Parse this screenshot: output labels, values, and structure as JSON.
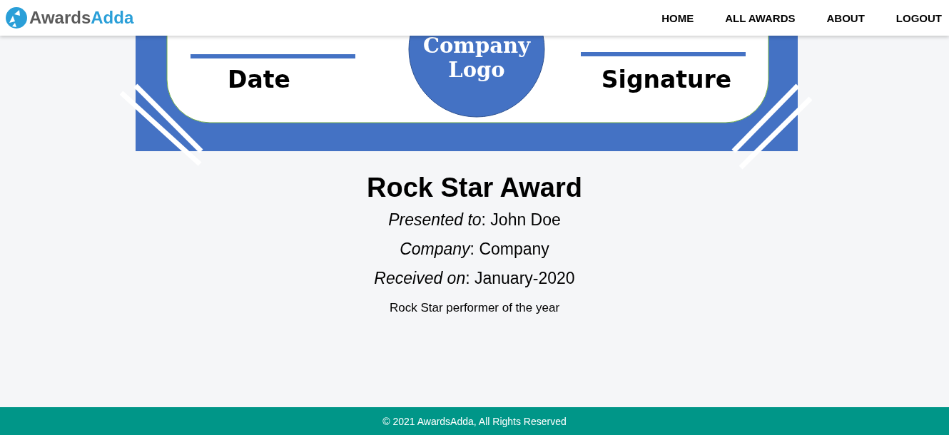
{
  "header": {
    "brand": [
      "Awards",
      "Adda"
    ],
    "nav": [
      "HOME",
      "ALL AWARDS",
      "ABOUT",
      "LOGOUT"
    ]
  },
  "certificate": {
    "date_label": "Date",
    "signature_label": "Signature",
    "logo_text": [
      "Company",
      "Logo"
    ]
  },
  "award": {
    "title": "Rock Star Award",
    "details": [
      "*Presented to*: John Doe",
      "*Company*: Company",
      "*Received on*: January-2020"
    ],
    "description": "Rock Star performer of the year"
  },
  "footer": "© 2021 AwardsAdda, All Rights Reserved"
}
